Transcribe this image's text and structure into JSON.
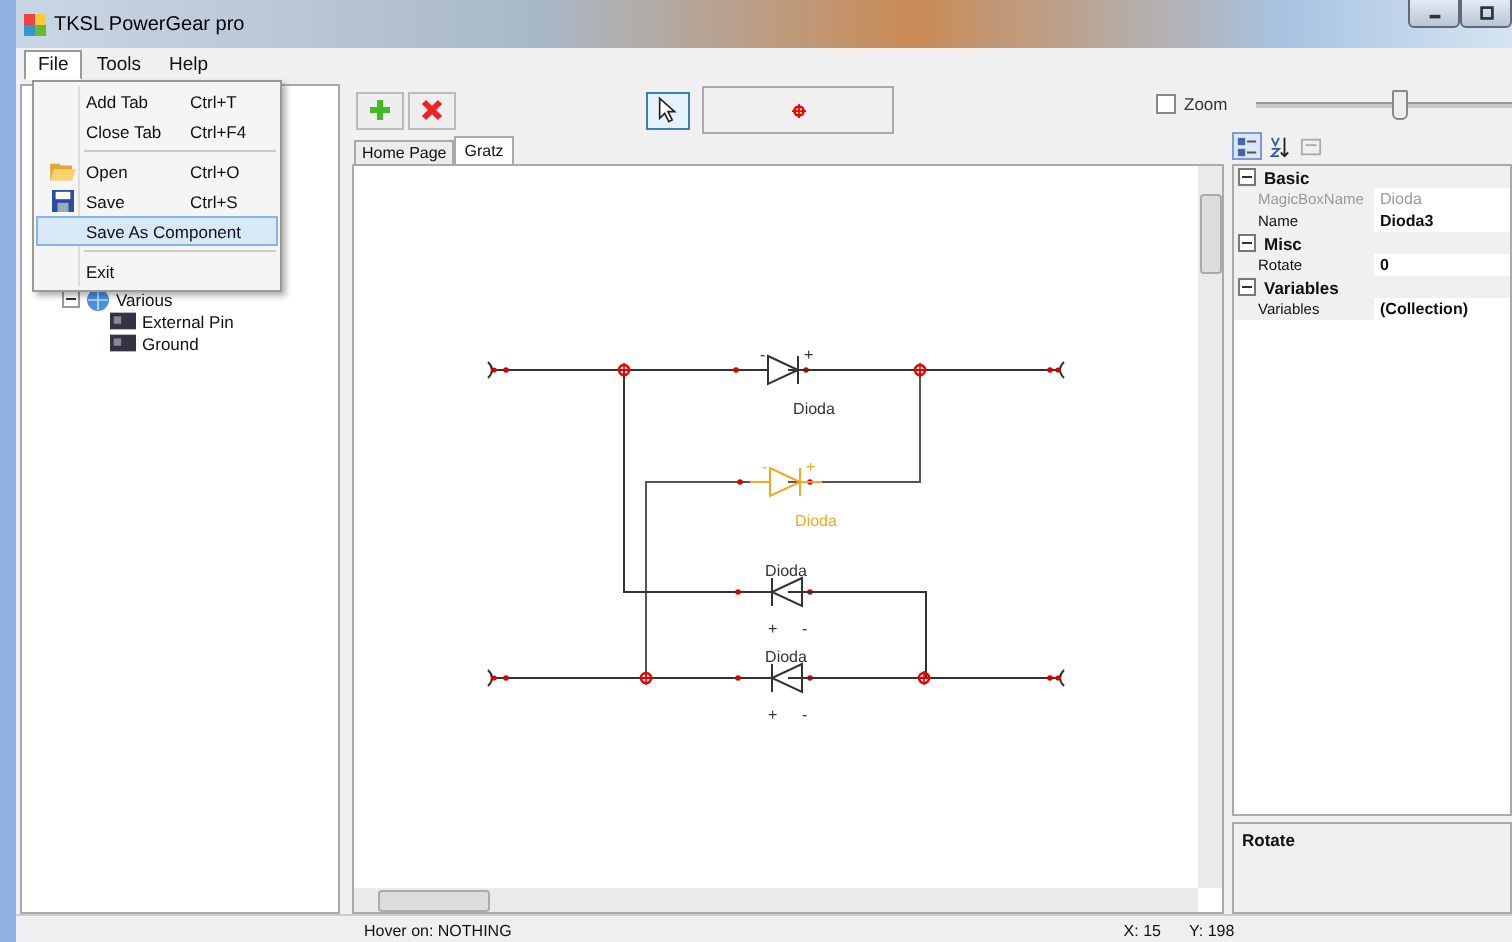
{
  "window": {
    "title": "TKSL PowerGear pro"
  },
  "menu_bar": [
    {
      "label": "File",
      "selected": true
    },
    {
      "label": "Tools",
      "selected": false
    },
    {
      "label": "Help",
      "selected": false
    }
  ],
  "file_menu": [
    {
      "kind": "item",
      "label": "Add Tab",
      "shortcut": "Ctrl+T",
      "selected": false
    },
    {
      "kind": "item",
      "label": "Close Tab",
      "shortcut": "Ctrl+F4",
      "selected": false
    },
    {
      "kind": "separator"
    },
    {
      "kind": "item",
      "label": "Open",
      "shortcut": "Ctrl+O",
      "selected": false
    },
    {
      "kind": "item",
      "label": "Save",
      "shortcut": "Ctrl+S",
      "selected": false
    },
    {
      "kind": "item",
      "label": "Save As Component",
      "selected": true
    },
    {
      "kind": "separator"
    },
    {
      "kind": "item",
      "label": "Exit",
      "selected": false
    }
  ],
  "tree": [
    {
      "label": "Various",
      "expanded": true,
      "children": [
        {
          "label": "External Pin"
        },
        {
          "label": "Ground"
        }
      ]
    }
  ],
  "toolbar": {
    "pointer_selected": true
  },
  "tabs": [
    {
      "label": "Home Page",
      "selected": false
    },
    {
      "label": "Gratz",
      "selected": true
    }
  ],
  "diagram": {
    "components": [
      {
        "label": "Dioda",
        "plus": "+",
        "minus": "-",
        "selected": false
      },
      {
        "label": "Dioda",
        "plus": "+",
        "minus": "-",
        "selected": true
      },
      {
        "label": "Dioda",
        "plus": "+",
        "minus": "-",
        "selected": false
      },
      {
        "label": "Dioda",
        "plus": "+",
        "minus": "-",
        "selected": false
      }
    ]
  },
  "zoom": {
    "label": "Zoom",
    "checked": false,
    "level": 0.46
  },
  "properties": [
    {
      "category": "Basic",
      "expanded": true,
      "rows": [
        {
          "name": "MagicBoxName",
          "value": "Dioda",
          "readonly": true
        },
        {
          "name": "Name",
          "value": "Dioda3",
          "readonly": false
        }
      ]
    },
    {
      "category": "Misc",
      "expanded": true,
      "rows": [
        {
          "name": "Rotate",
          "value": "0",
          "readonly": false
        }
      ]
    },
    {
      "category": "Variables",
      "expanded": true,
      "rows": [
        {
          "name": "Variables",
          "value": "(Collection)",
          "readonly": false
        }
      ]
    }
  ],
  "description": {
    "title": "Rotate"
  },
  "status_bar": {
    "hover": "Hover on: NOTHING",
    "x": "X: 15",
    "y": "Y: 198"
  }
}
